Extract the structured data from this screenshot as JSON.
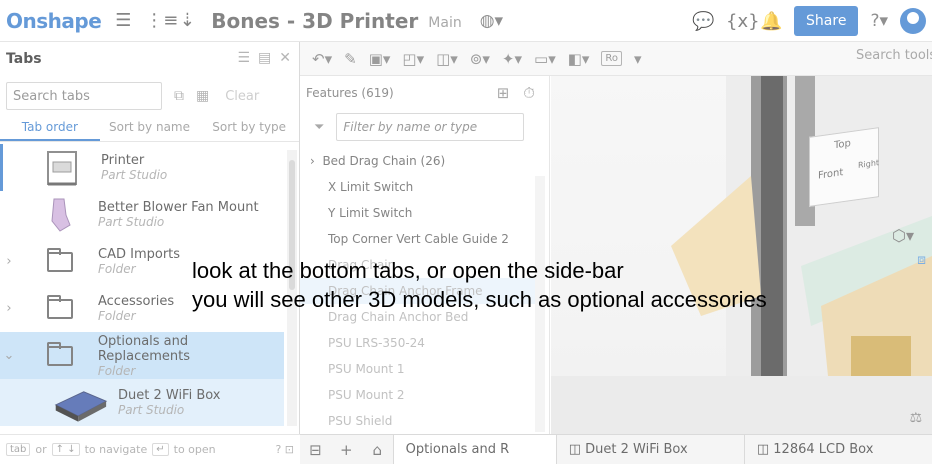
{
  "app": {
    "logo": "Onshape",
    "doc_title": "Bones - 3D Printer",
    "branch": "Main",
    "share_label": "Share"
  },
  "tabs_panel": {
    "title": "Tabs",
    "search_placeholder": "Search tabs",
    "clear_label": "Clear",
    "sort": {
      "tab_order": "Tab order",
      "by_name": "Sort by name",
      "by_type": "Sort by type"
    },
    "items": [
      {
        "name": "Printer",
        "type": "Part Studio"
      },
      {
        "name": "Better Blower Fan Mount",
        "type": "Part Studio"
      },
      {
        "name": "CAD Imports",
        "type": "Folder"
      },
      {
        "name": "Accessories",
        "type": "Folder"
      },
      {
        "name": "Optionals and Replacements",
        "type": "Folder"
      },
      {
        "name": "Duet 2 WiFi Box",
        "type": "Part Studio"
      }
    ],
    "footer": {
      "tab": "tab",
      "or": "or",
      "navigate": "to navigate",
      "open": "to open"
    }
  },
  "toolbar": {
    "search_tools": "Search tools",
    "ro": "Ro"
  },
  "features": {
    "header": "Features (619)",
    "filter_placeholder": "Filter by name or type",
    "group": "Bed Drag Chain (26)",
    "items": [
      "X Limit Switch",
      "Y Limit Switch",
      "Top Corner Vert Cable Guide 2",
      "Drag Chain",
      "Drag Chain Anchor Frame",
      "Drag Chain Anchor Bed",
      "PSU LRS-350-24",
      "PSU Mount 1",
      "PSU Mount 2",
      "PSU Shield"
    ]
  },
  "viewcube": {
    "top": "Top",
    "front": "Front",
    "right": "Right"
  },
  "bottom_tabs": {
    "active": "Optionals and R",
    "tab2": "Duet 2 WiFi Box",
    "tab3": "12864 LCD Box"
  },
  "caption": {
    "line1": "look at the bottom tabs, or open the side-bar",
    "line2": "you will see other 3D models, such as optional accessories"
  }
}
